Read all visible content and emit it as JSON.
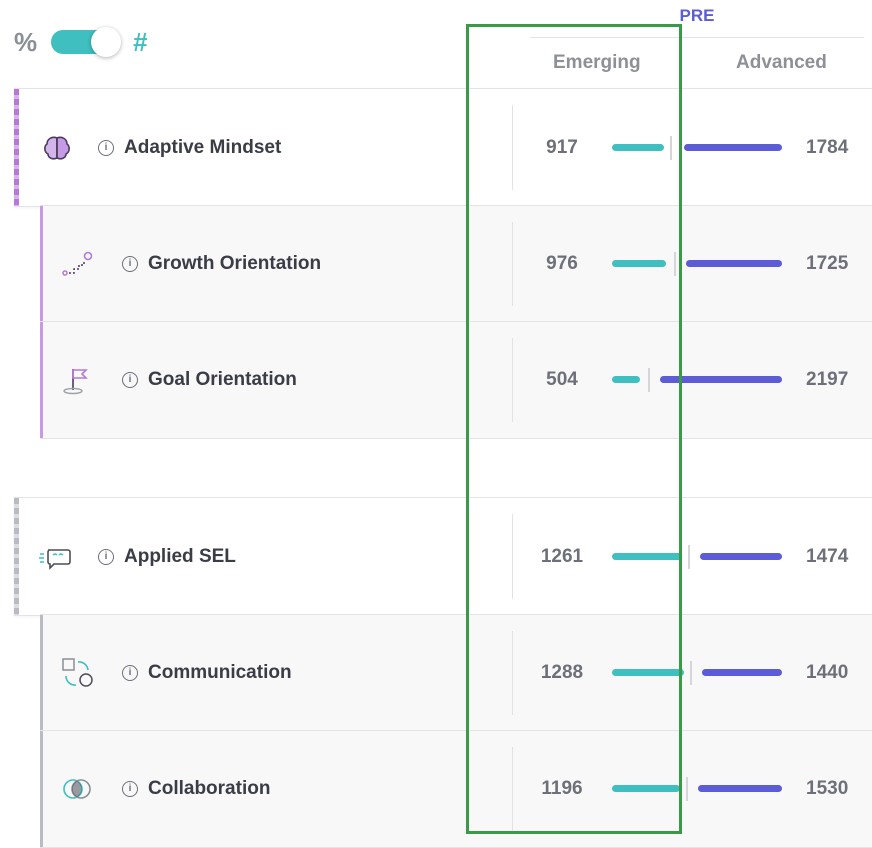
{
  "toggle": {
    "left_symbol": "%",
    "right_symbol": "#",
    "mode": "#"
  },
  "header": {
    "group": "PRE",
    "emerging": "Emerging",
    "advanced": "Advanced"
  },
  "rows": [
    {
      "type": "parent",
      "icon": "brain-icon",
      "label": "Adaptive Mindset",
      "emerging": "917",
      "advanced": "1784"
    },
    {
      "type": "child",
      "icon": "stairs-growth-icon",
      "label": "Growth Orientation",
      "emerging": "976",
      "advanced": "1725"
    },
    {
      "type": "child",
      "icon": "flag-icon",
      "label": "Goal Orientation",
      "emerging": "504",
      "advanced": "2197"
    },
    {
      "type": "parent",
      "icon": "chat-bubble-icon",
      "label": "Applied SEL",
      "emerging": "1261",
      "advanced": "1474"
    },
    {
      "type": "child",
      "icon": "shapes-icon",
      "label": "Communication",
      "emerging": "1288",
      "advanced": "1440"
    },
    {
      "type": "child",
      "icon": "overlap-circles-icon",
      "label": "Collaboration",
      "emerging": "1196",
      "advanced": "1530"
    }
  ],
  "colors": {
    "emerging": "#3fbfbf",
    "advanced": "#5c5cd6",
    "highlight": "#3a9a47"
  }
}
